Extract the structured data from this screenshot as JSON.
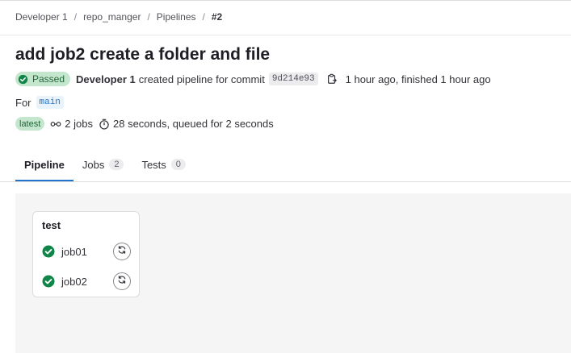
{
  "breadcrumb": [
    "Developer 1",
    "repo_manger",
    "Pipelines",
    "#2"
  ],
  "header": {
    "title": "add job2 create a folder and file",
    "status_badge": "Passed",
    "author": "Developer 1",
    "created_text": "created pipeline for commit",
    "commit_sha": "9d214e93",
    "timing_text": "1 hour ago, finished 1 hour ago",
    "for_label": "For",
    "ref": "main",
    "latest_badge": "latest",
    "jobs_count": "2 jobs",
    "duration": "28 seconds, queued for 2 seconds"
  },
  "tabs": [
    {
      "label": "Pipeline",
      "count": null,
      "active": true
    },
    {
      "label": "Jobs",
      "count": "2",
      "active": false
    },
    {
      "label": "Tests",
      "count": "0",
      "active": false
    }
  ],
  "pipeline": {
    "stage": "test",
    "jobs": [
      {
        "name": "job01",
        "status": "success"
      },
      {
        "name": "job02",
        "status": "success"
      }
    ]
  },
  "colors": {
    "success": "#108548",
    "success_badge_bg": "#c3e6cd",
    "accent": "#1f75cb"
  },
  "icons": [
    "status-success-icon",
    "copy-icon",
    "pipeline-jobs-icon",
    "timer-icon",
    "retry-icon"
  ]
}
